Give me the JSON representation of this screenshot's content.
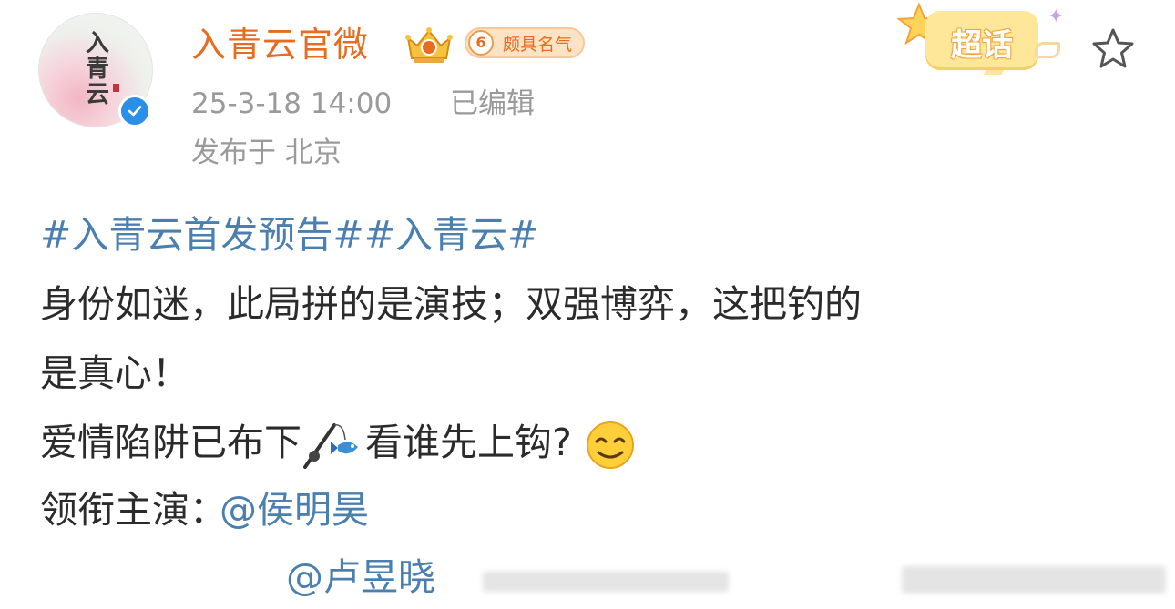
{
  "post": {
    "author": {
      "name": "入青云官微",
      "avatar_text": "入青云",
      "verified_icon": "verified-check-icon",
      "crown_icon": "vip-crown-icon",
      "fame_level": "6",
      "fame_label": "颇具名气"
    },
    "meta": {
      "timestamp": "25-3-18 14:00",
      "edited_label": "已编辑",
      "location": "发布于 北京"
    },
    "supertopic_label": "超话",
    "favorite_icon": "star-outline-icon",
    "content": {
      "hashtags": "#入青云首发预告##入青云#",
      "line1": "身份如迷，此局拼的是演技；双强博弈，这把钓的",
      "line2": "是真心！",
      "line3_text": "爱情陷阱已布下",
      "line3_icon": "fishing-rod-icon",
      "line3_text2": "看谁先上钩?",
      "line3_emoji": "smirk-emoji-icon",
      "line4_label": "领衔主演：",
      "mention1": "@侯明昊",
      "mention2": "@卢昱晓"
    }
  },
  "colors": {
    "username": "#e86c1f",
    "link": "#4a7fb0",
    "meta": "#9a9a9a",
    "text": "#2b2b2b",
    "verified": "#2a8fe8"
  }
}
